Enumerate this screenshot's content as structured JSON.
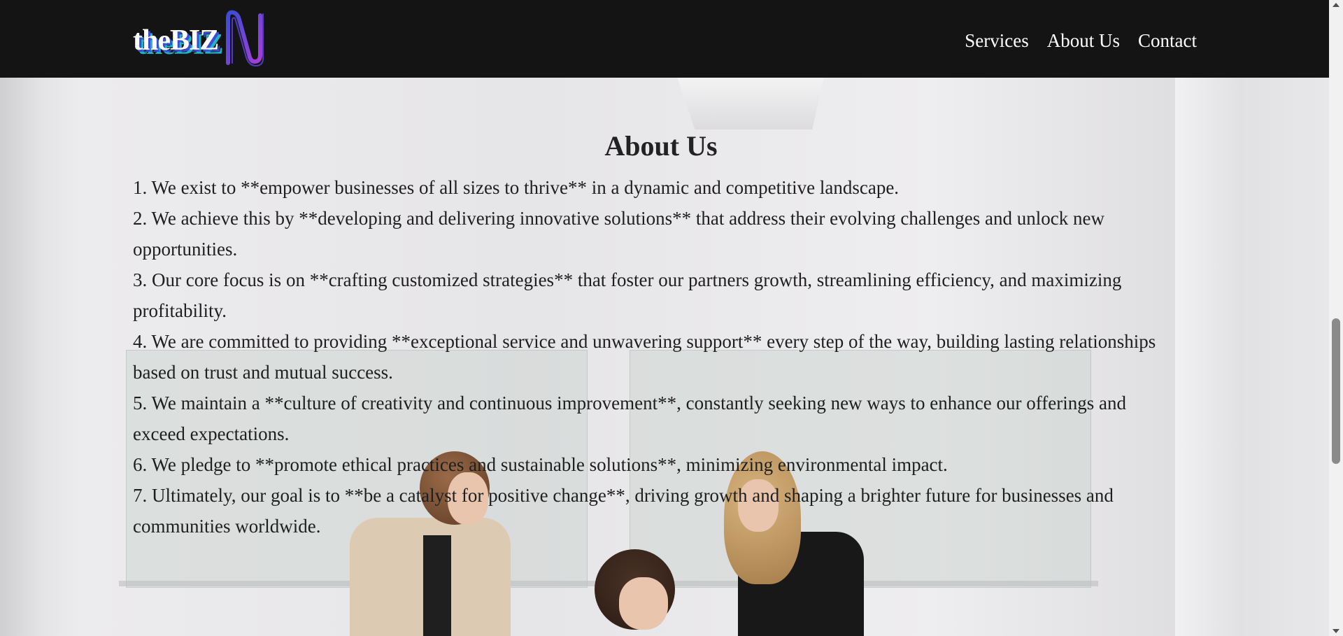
{
  "brand": {
    "logo_text": "theBIZ"
  },
  "nav": {
    "items": [
      {
        "label": "Services"
      },
      {
        "label": "About Us"
      },
      {
        "label": "Contact"
      }
    ]
  },
  "about": {
    "heading": "About Us",
    "points": [
      "1. We exist to **empower businesses of all sizes to thrive** in a dynamic and competitive landscape.",
      "2. We achieve this by **developing and delivering innovative solutions** that address their evolving challenges and unlock new opportunities.",
      "3. Our core focus is on **crafting customized strategies** that foster our partners growth, streamlining efficiency, and maximizing profitability.",
      "4. We are committed to providing **exceptional service and unwavering support** every step of the way, building lasting relationships based on trust and mutual success.",
      "5. We maintain a **culture of creativity and continuous improvement**, constantly seeking new ways to enhance our offerings and exceed expectations.",
      "6. We pledge to **promote ethical practices and sustainable solutions**, minimizing environmental impact.",
      "7. Ultimately, our goal is to **be a catalyst for positive change**, driving growth and shaping a brighter future for businesses and communities worldwide."
    ]
  },
  "colors": {
    "header_bg": "#141414",
    "nav_text": "#ffffff",
    "body_text": "#1f1f1f",
    "logo_gradient": [
      "#3b4cd6",
      "#a63fd8"
    ]
  },
  "scrollbar": {
    "position_fraction": 0.55
  }
}
